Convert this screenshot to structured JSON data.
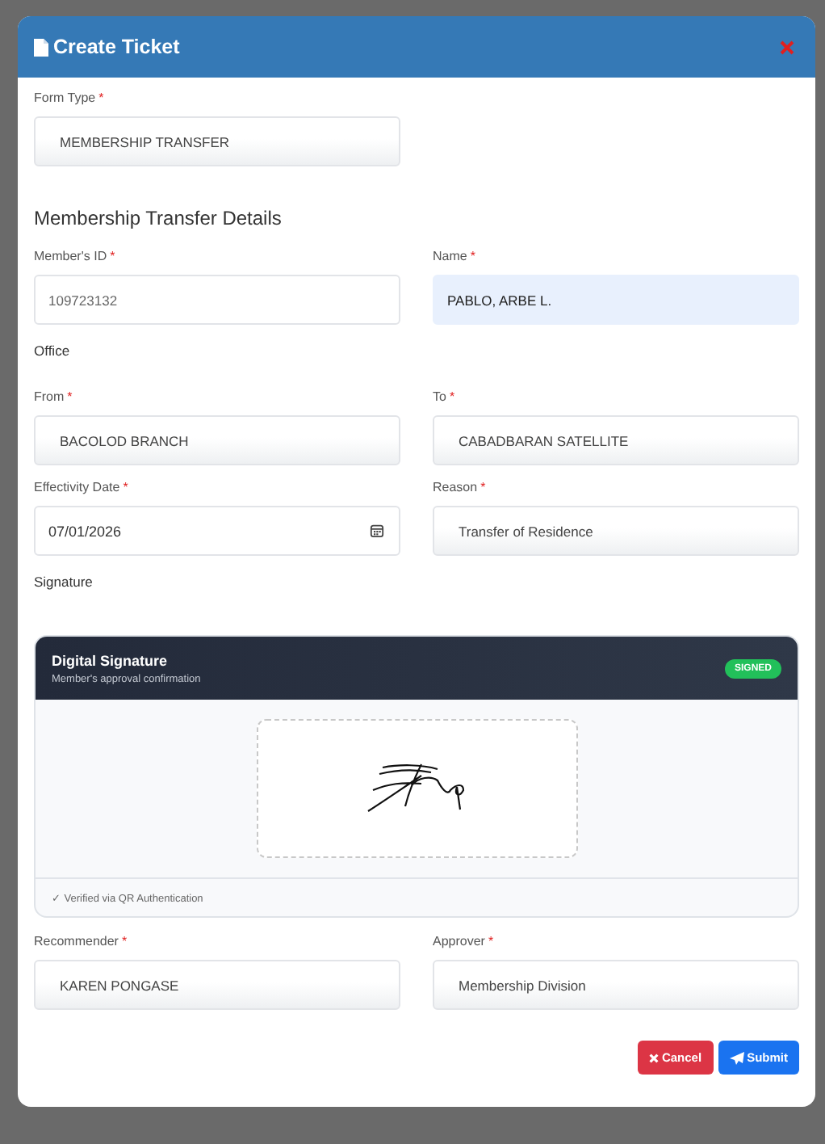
{
  "dialog": {
    "title": "Create Ticket"
  },
  "form_type": {
    "label": "Form Type",
    "mark": "*",
    "kind": "select",
    "value": "MEMBERSHIP TRANSFER"
  },
  "section_title": "Membership Transfer Details",
  "member_row": [
    {
      "label": "Member's ID",
      "mark": "*",
      "kind": "input",
      "value": "109723132"
    },
    {
      "label": "Name",
      "mark": "*",
      "kind": "filled",
      "value": "PABLO, ARBE L."
    }
  ],
  "office_title": "Office",
  "office_rows": [
    [
      {
        "label": "From",
        "mark": "*",
        "kind": "select",
        "value": "BACOLOD BRANCH"
      },
      {
        "label": "To",
        "mark": "*",
        "kind": "select",
        "value": "CABADBARAN SATELLITE"
      }
    ],
    [
      {
        "label": "Effectivity Date",
        "mark": "*",
        "kind": "date",
        "value": "07/01/2026"
      },
      {
        "label": "Reason",
        "mark": "*",
        "kind": "select",
        "value": "Transfer of Residence"
      }
    ]
  ],
  "signature_title": "Signature",
  "signature_card": {
    "title": "Digital Signature",
    "subtitle": "Member's approval confirmation",
    "badge": "SIGNED",
    "signed": true,
    "footer": "✓ Verified via QR Authentication"
  },
  "approval_row": [
    {
      "label": "Recommender",
      "mark": "*",
      "kind": "select",
      "value": "KAREN PONGASE"
    },
    {
      "label": "Approver",
      "mark": "*",
      "kind": "select",
      "value": "Membership Division"
    }
  ],
  "buttons": [
    {
      "label": "Cancel",
      "kind": "cancel"
    },
    {
      "label": "Submit",
      "kind": "submit"
    }
  ]
}
